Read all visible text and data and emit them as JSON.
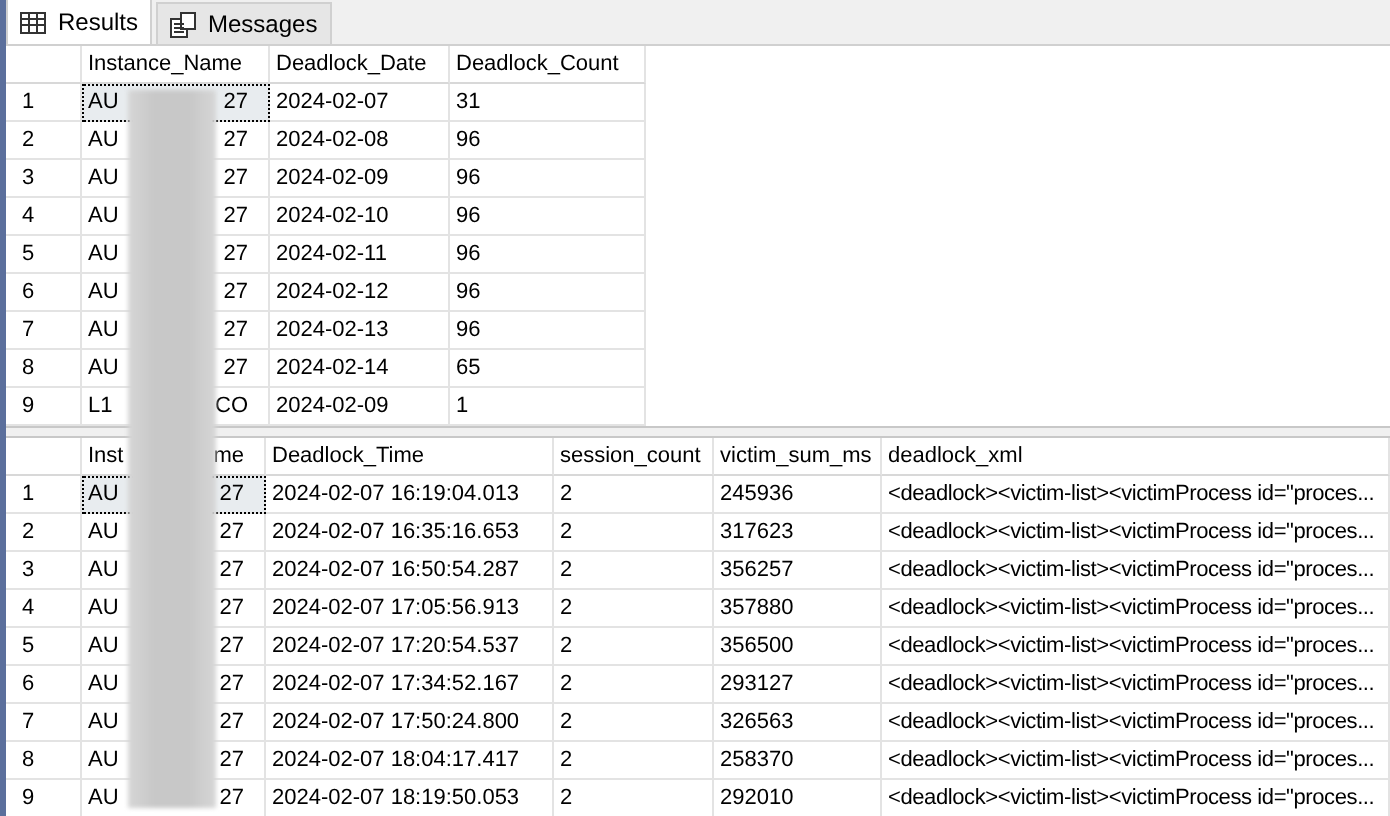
{
  "tabs": [
    {
      "label": "Results",
      "selected": true
    },
    {
      "label": "Messages",
      "selected": false
    }
  ],
  "grids": [
    {
      "columns": [
        {
          "label": "Instance_Name"
        },
        {
          "label": "Deadlock_Date"
        },
        {
          "label": "Deadlock_Count"
        }
      ],
      "rows": [
        {
          "number": "1",
          "focused": true,
          "cells": [
            {
              "start": "AU",
              "end": "27"
            },
            "2024-02-07",
            "31"
          ]
        },
        {
          "number": "2",
          "focused": false,
          "cells": [
            {
              "start": "AU",
              "end": "27"
            },
            "2024-02-08",
            "96"
          ]
        },
        {
          "number": "3",
          "focused": false,
          "cells": [
            {
              "start": "AU",
              "end": "27"
            },
            "2024-02-09",
            "96"
          ]
        },
        {
          "number": "4",
          "focused": false,
          "cells": [
            {
              "start": "AU",
              "end": "27"
            },
            "2024-02-10",
            "96"
          ]
        },
        {
          "number": "5",
          "focused": false,
          "cells": [
            {
              "start": "AU",
              "end": "27"
            },
            "2024-02-11",
            "96"
          ]
        },
        {
          "number": "6",
          "focused": false,
          "cells": [
            {
              "start": "AU",
              "end": "27"
            },
            "2024-02-12",
            "96"
          ]
        },
        {
          "number": "7",
          "focused": false,
          "cells": [
            {
              "start": "AU",
              "end": "27"
            },
            "2024-02-13",
            "96"
          ]
        },
        {
          "number": "8",
          "focused": false,
          "cells": [
            {
              "start": "AU",
              "end": "27"
            },
            "2024-02-14",
            "65"
          ]
        },
        {
          "number": "9",
          "focused": false,
          "cells": [
            {
              "start": "L1",
              "end": "CO"
            },
            "2024-02-09",
            "1"
          ]
        }
      ]
    },
    {
      "columns": [
        {
          "label": {
            "start": "Inst",
            "end": "me"
          }
        },
        {
          "label": "Deadlock_Time"
        },
        {
          "label": "session_count"
        },
        {
          "label": "victim_sum_ms"
        },
        {
          "label": "deadlock_xml"
        }
      ],
      "rows": [
        {
          "number": "1",
          "focused": true,
          "cells": [
            {
              "start": "AU",
              "end": "27"
            },
            "2024-02-07 16:19:04.013",
            "2",
            "245936",
            "<deadlock><victim-list><victimProcess id=\"proces..."
          ]
        },
        {
          "number": "2",
          "focused": false,
          "cells": [
            {
              "start": "AU",
              "end": "27"
            },
            "2024-02-07 16:35:16.653",
            "2",
            "317623",
            "<deadlock><victim-list><victimProcess id=\"proces..."
          ]
        },
        {
          "number": "3",
          "focused": false,
          "cells": [
            {
              "start": "AU",
              "end": "27"
            },
            "2024-02-07 16:50:54.287",
            "2",
            "356257",
            "<deadlock><victim-list><victimProcess id=\"proces..."
          ]
        },
        {
          "number": "4",
          "focused": false,
          "cells": [
            {
              "start": "AU",
              "end": "27"
            },
            "2024-02-07 17:05:56.913",
            "2",
            "357880",
            "<deadlock><victim-list><victimProcess id=\"proces..."
          ]
        },
        {
          "number": "5",
          "focused": false,
          "cells": [
            {
              "start": "AU",
              "end": "27"
            },
            "2024-02-07 17:20:54.537",
            "2",
            "356500",
            "<deadlock><victim-list><victimProcess id=\"proces..."
          ]
        },
        {
          "number": "6",
          "focused": false,
          "cells": [
            {
              "start": "AU",
              "end": "27"
            },
            "2024-02-07 17:34:52.167",
            "2",
            "293127",
            "<deadlock><victim-list><victimProcess id=\"proces..."
          ]
        },
        {
          "number": "7",
          "focused": false,
          "cells": [
            {
              "start": "AU",
              "end": "27"
            },
            "2024-02-07 17:50:24.800",
            "2",
            "326563",
            "<deadlock><victim-list><victimProcess id=\"proces..."
          ]
        },
        {
          "number": "8",
          "focused": false,
          "cells": [
            {
              "start": "AU",
              "end": "27"
            },
            "2024-02-07 18:04:17.417",
            "2",
            "258370",
            "<deadlock><victim-list><victimProcess id=\"proces..."
          ]
        },
        {
          "number": "9",
          "focused": false,
          "cells": [
            {
              "start": "AU",
              "end": "27"
            },
            "2024-02-07 18:19:50.053",
            "2",
            "292010",
            "<deadlock><victim-list><victimProcess id=\"proces..."
          ]
        }
      ]
    }
  ]
}
